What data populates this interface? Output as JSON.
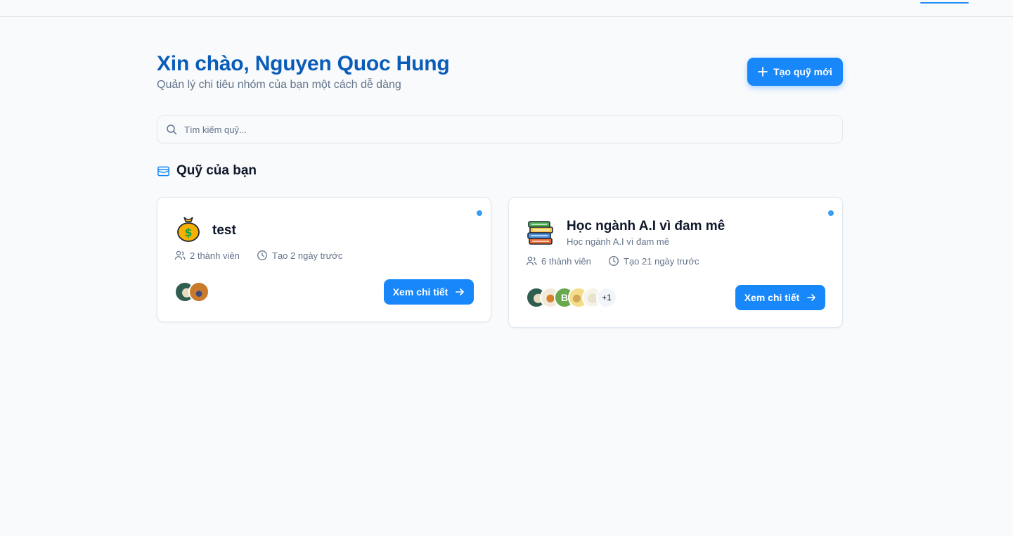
{
  "header": {
    "greeting": "Xin chào, Nguyen Quoc Hung",
    "subtitle": "Quản lý chi tiêu nhóm của bạn một cách dễ dàng",
    "create_button_label": "Tạo quỹ mới"
  },
  "search": {
    "placeholder": "Tìm kiếm quỹ...",
    "value": ""
  },
  "section": {
    "title": "Quỹ của bạn",
    "icon": "wallet-icon"
  },
  "funds": [
    {
      "icon": "money-bag-icon",
      "name": "test",
      "description": "",
      "members": "2 thành viên",
      "created": "Tạo 2 ngày trước",
      "avatars": [
        "avatar-1",
        "avatar-2"
      ],
      "more_count": "",
      "detail_label": "Xem chi tiết"
    },
    {
      "icon": "books-icon",
      "name": "Học ngành A.I vì đam mê",
      "description": "Học ngành A.I vì đam mê",
      "members": "6 thành viên",
      "created": "Tạo 21 ngày trước",
      "avatars": [
        "avatar-1",
        "avatar-2",
        "B",
        "avatar-4",
        "avatar-5"
      ],
      "more_count": "+1",
      "detail_label": "Xem chi tiết"
    }
  ],
  "colors": {
    "primary": "#1787fa",
    "greeting": "#0a5cb8",
    "status_dot": "#3b9df0"
  }
}
